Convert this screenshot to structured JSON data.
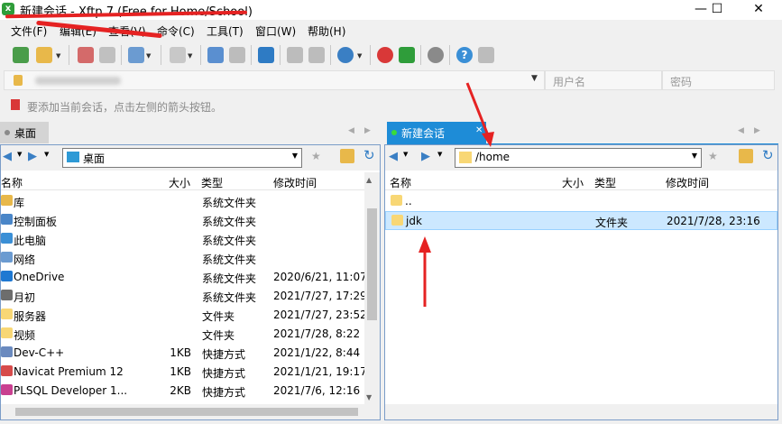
{
  "window": {
    "title": "新建会话 - Xftp 7 (Free for Home/School)",
    "minimize": "—",
    "maximize": "☐",
    "close": "✕"
  },
  "menu": [
    "文件(F)",
    "编辑(E)",
    "查看(V)",
    "命令(C)",
    "工具(T)",
    "窗口(W)",
    "帮助(H)"
  ],
  "address": {
    "user_placeholder": "用户名",
    "password_placeholder": "密码"
  },
  "hint": "要添加当前会话，点击左侧的箭头按钮。",
  "left": {
    "tab": "桌面",
    "path": "桌面",
    "columns": [
      "名称",
      "大小",
      "类型",
      "修改时间"
    ],
    "rows": [
      {
        "name": "库",
        "size": "",
        "type": "系统文件夹",
        "mtime": "",
        "icon": "library-icon"
      },
      {
        "name": "控制面板",
        "size": "",
        "type": "系统文件夹",
        "mtime": "",
        "icon": "control-panel-icon"
      },
      {
        "name": "此电脑",
        "size": "",
        "type": "系统文件夹",
        "mtime": "",
        "icon": "computer-icon"
      },
      {
        "name": "网络",
        "size": "",
        "type": "系统文件夹",
        "mtime": "",
        "icon": "network-icon"
      },
      {
        "name": "OneDrive",
        "size": "",
        "type": "系统文件夹",
        "mtime": "2020/6/21, 11:07",
        "icon": "onedrive-icon"
      },
      {
        "name": "月初",
        "size": "",
        "type": "系统文件夹",
        "mtime": "2021/7/27, 17:29",
        "icon": "user-icon"
      },
      {
        "name": "服务器",
        "size": "",
        "type": "文件夹",
        "mtime": "2021/7/27, 23:52",
        "icon": "folder-icon"
      },
      {
        "name": "视频",
        "size": "",
        "type": "文件夹",
        "mtime": "2021/7/28, 8:22",
        "icon": "folder-icon"
      },
      {
        "name": "Dev-C++",
        "size": "1KB",
        "type": "快捷方式",
        "mtime": "2021/1/22, 8:44",
        "icon": "devcpp-icon"
      },
      {
        "name": "Navicat Premium 12",
        "size": "1KB",
        "type": "快捷方式",
        "mtime": "2021/1/21, 19:17",
        "icon": "navicat-icon"
      },
      {
        "name": "PLSQL Developer 1...",
        "size": "2KB",
        "type": "快捷方式",
        "mtime": "2021/7/6, 12:16",
        "icon": "plsql-icon"
      }
    ]
  },
  "right": {
    "tab": "新建会话",
    "path": "/home",
    "columns": [
      "名称",
      "大小",
      "类型",
      "修改时间"
    ],
    "rows": [
      {
        "name": "..",
        "size": "",
        "type": "",
        "mtime": "",
        "icon": "folder-icon"
      },
      {
        "name": "jdk",
        "size": "",
        "type": "文件夹",
        "mtime": "2021/7/28, 23:16",
        "icon": "folder-icon"
      }
    ],
    "selected_index": 1
  },
  "colors": {
    "accent": "#1e8cd7",
    "selection": "#cce8ff",
    "annotation": "#e52222",
    "folder": "#f8d775"
  }
}
